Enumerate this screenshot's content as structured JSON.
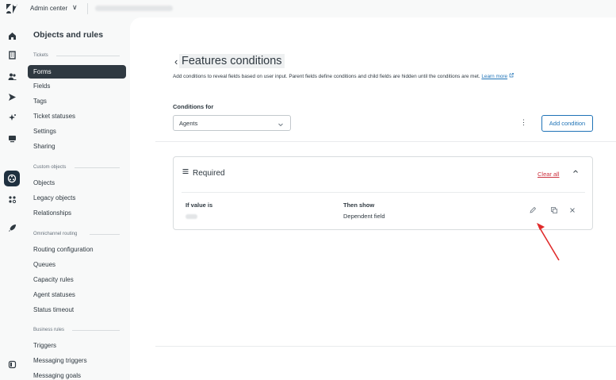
{
  "topbar": {
    "product": "Admin center",
    "chevron": "∨"
  },
  "nav": {
    "title": "Objects and rules",
    "sections": [
      {
        "label": "Tickets",
        "items": [
          "Forms",
          "Fields",
          "Tags",
          "Ticket statuses",
          "Settings",
          "Sharing"
        ]
      },
      {
        "label": "Custom objects",
        "items": [
          "Objects",
          "Legacy objects",
          "Relationships"
        ]
      },
      {
        "label": "Omnichannel routing",
        "items": [
          "Routing configuration",
          "Queues",
          "Capacity rules",
          "Agent statuses",
          "Status timeout"
        ]
      },
      {
        "label": "Business rules",
        "items": [
          "Triggers",
          "Messaging triggers",
          "Messaging goals"
        ]
      }
    ]
  },
  "page": {
    "back": "‹",
    "title": "Features conditions",
    "description": "Add conditions to reveal fields based on user input. Parent fields define conditions and child fields are hidden until the conditions are met.",
    "learn_more": "Learn more",
    "conditions_for_label": "Conditions for",
    "conditions_for_value": "Agents",
    "add_condition": "Add condition",
    "kebab": "⋮"
  },
  "card": {
    "title": "Required",
    "clear_all": "Clear all",
    "col_if": "If value is",
    "col_then": "Then show",
    "then_value": "Dependent field"
  },
  "icons": [
    "zendesk-logo-icon",
    "home-icon",
    "building-icon",
    "people-icon",
    "send-icon",
    "sparkle-icon",
    "monitor-icon",
    "objects-icon",
    "apps-icon",
    "rocket-icon",
    "panel-icon",
    "pencil-icon",
    "copy-icon",
    "close-icon",
    "chevron-up-icon",
    "lines-icon"
  ],
  "colors": {
    "accent": "#1f73b7",
    "danger": "#cc3340",
    "nav_active": "#2f3941",
    "annotation_arrow": "#e02b2b"
  }
}
